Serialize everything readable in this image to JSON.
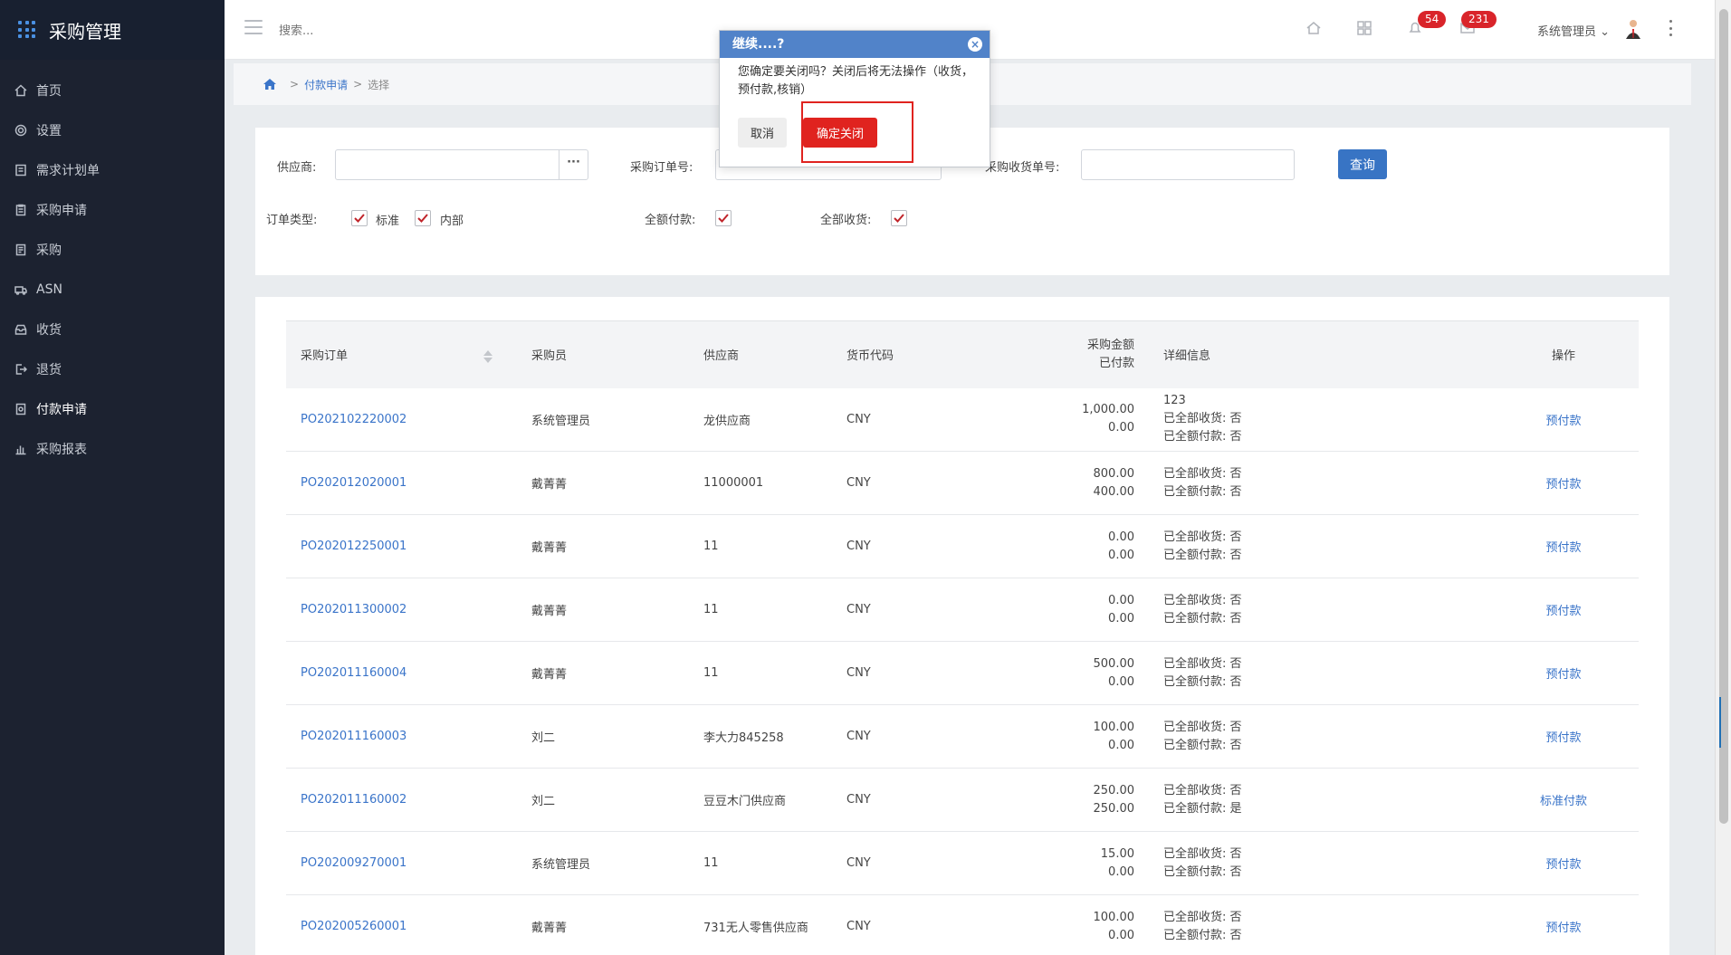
{
  "sidebar": {
    "title": "采购管理",
    "items": [
      {
        "label": "首页",
        "icon": "home-icon"
      },
      {
        "label": "设置",
        "icon": "gear-icon"
      },
      {
        "label": "需求计划单",
        "icon": "document-icon"
      },
      {
        "label": "采购申请",
        "icon": "clipboard-icon"
      },
      {
        "label": "采购",
        "icon": "cart-icon"
      },
      {
        "label": "ASN",
        "icon": "truck-icon"
      },
      {
        "label": "收货",
        "icon": "inbox-icon"
      },
      {
        "label": "退货",
        "icon": "return-icon"
      },
      {
        "label": "付款申请",
        "icon": "payment-icon"
      },
      {
        "label": "采购报表",
        "icon": "chart-icon"
      }
    ]
  },
  "header": {
    "search_placeholder": "搜索...",
    "badge_notifications": "54",
    "badge_messages": "231",
    "user": "系统管理员"
  },
  "breadcrumb": {
    "link": "付款申请",
    "current": "选择"
  },
  "filter": {
    "supplier_label": "供应商:",
    "po_label": "采购订单号:",
    "receipt_label": "采购收货单号:",
    "query_label": "查询",
    "order_type_label": "订单类型:",
    "type_standard": "标准",
    "type_internal": "内部",
    "full_pay_label": "全额付款:",
    "full_receive_label": "全部收货:"
  },
  "table": {
    "headers": {
      "po": "采购订单",
      "buyer": "采购员",
      "supplier": "供应商",
      "currency": "货币代码",
      "amount": "采购金额",
      "paid": "已付款",
      "detail": "详细信息",
      "ops": "操作"
    },
    "rows": [
      {
        "po": "PO202102220002",
        "buyer": "系统管理员",
        "supplier": "龙供应商",
        "currency": "CNY",
        "amount": "1,000.00",
        "paid": "0.00",
        "note": "123",
        "received": "已全部收货: 否",
        "fullpaid": "已全额付款: 否",
        "op": "预付款"
      },
      {
        "po": "PO202012020001",
        "buyer": "戴菁菁",
        "supplier": "11000001",
        "currency": "CNY",
        "amount": "800.00",
        "paid": "400.00",
        "note": "",
        "received": "已全部收货: 否",
        "fullpaid": "已全额付款: 否",
        "op": "预付款"
      },
      {
        "po": "PO202012250001",
        "buyer": "戴菁菁",
        "supplier": "11",
        "currency": "CNY",
        "amount": "0.00",
        "paid": "0.00",
        "note": "",
        "received": "已全部收货: 否",
        "fullpaid": "已全额付款: 否",
        "op": "预付款"
      },
      {
        "po": "PO202011300002",
        "buyer": "戴菁菁",
        "supplier": "11",
        "currency": "CNY",
        "amount": "0.00",
        "paid": "0.00",
        "note": "",
        "received": "已全部收货: 否",
        "fullpaid": "已全额付款: 否",
        "op": "预付款"
      },
      {
        "po": "PO202011160004",
        "buyer": "戴菁菁",
        "supplier": "11",
        "currency": "CNY",
        "amount": "500.00",
        "paid": "0.00",
        "note": "",
        "received": "已全部收货: 否",
        "fullpaid": "已全额付款: 否",
        "op": "预付款"
      },
      {
        "po": "PO202011160003",
        "buyer": "刘二",
        "supplier": "李大力845258",
        "currency": "CNY",
        "amount": "100.00",
        "paid": "0.00",
        "note": "",
        "received": "已全部收货: 否",
        "fullpaid": "已全额付款: 否",
        "op": "预付款"
      },
      {
        "po": "PO202011160002",
        "buyer": "刘二",
        "supplier": "豆豆木门供应商",
        "currency": "CNY",
        "amount": "250.00",
        "paid": "250.00",
        "note": "",
        "received": "已全部收货: 否",
        "fullpaid": "已全额付款: 是",
        "op": "标准付款"
      },
      {
        "po": "PO202009270001",
        "buyer": "系统管理员",
        "supplier": "11",
        "currency": "CNY",
        "amount": "15.00",
        "paid": "0.00",
        "note": "",
        "received": "已全部收货: 否",
        "fullpaid": "已全额付款: 否",
        "op": "预付款"
      },
      {
        "po": "PO202005260001",
        "buyer": "戴菁菁",
        "supplier": "731无人零售供应商",
        "currency": "CNY",
        "amount": "100.00",
        "paid": "0.00",
        "note": "",
        "received": "已全部收货: 否",
        "fullpaid": "已全额付款: 否",
        "op": "预付款"
      }
    ]
  },
  "dialog": {
    "title": "继续....?",
    "message": "您确定要关闭吗？关闭后将无法操作（收货，预付款,核销）",
    "cancel": "取消",
    "confirm": "确定关闭"
  },
  "colors": {
    "sidebar_bg": "#1c2230",
    "accent": "#3874c4",
    "danger": "#e0231f"
  }
}
